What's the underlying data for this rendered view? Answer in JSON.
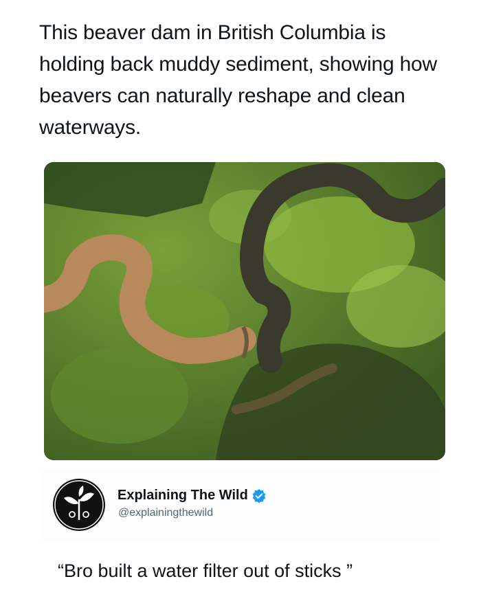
{
  "tweet": {
    "text": "This beaver dam in British Columbia is holding back muddy sediment, showing how beavers can naturally reshape and clean waterways."
  },
  "media": {
    "icon": "aerial-photo-river-beaver-dam"
  },
  "author": {
    "display_name": "Explaining The Wild",
    "handle": "@explainingthewild",
    "verified": true,
    "avatar_icon": "sprouting-plant-logo",
    "verified_color": "#1d9bf0"
  },
  "reply": {
    "text": "“Bro built a water filter out of sticks ”"
  }
}
